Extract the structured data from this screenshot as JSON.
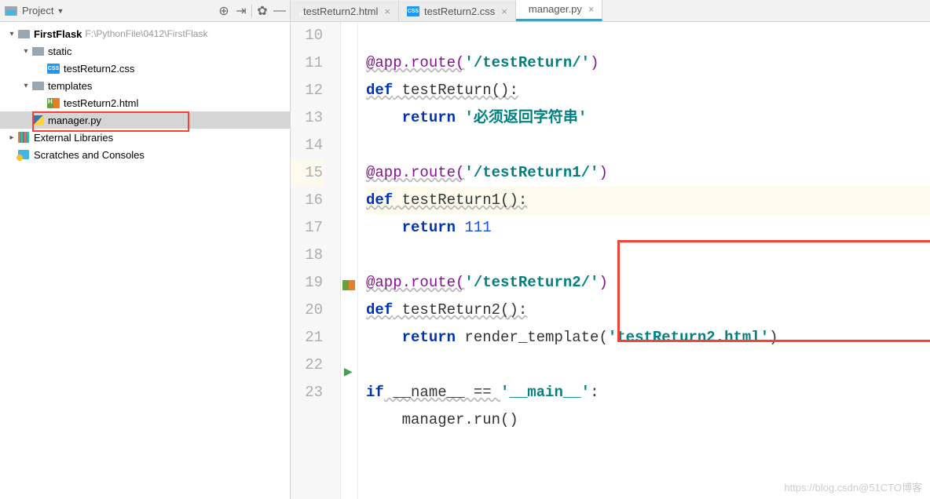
{
  "sidebar": {
    "title": "Project",
    "root": {
      "name": "FirstFlask",
      "path": "F:\\PythonFile\\0412\\FirstFlask"
    },
    "static": {
      "name": "static"
    },
    "static_child": {
      "name": "testReturn2.css"
    },
    "templates": {
      "name": "templates"
    },
    "templates_child": {
      "name": "testReturn2.html"
    },
    "manager": {
      "name": "manager.py"
    },
    "ext_lib": {
      "name": "External Libraries"
    },
    "scratch": {
      "name": "Scratches and Consoles"
    }
  },
  "tabs": [
    {
      "label": "testReturn2.html",
      "type": "html"
    },
    {
      "label": "testReturn2.css",
      "type": "css"
    },
    {
      "label": "manager.py",
      "type": "py",
      "active": true
    }
  ],
  "code": {
    "l10": {
      "a": "@app.route(",
      "b": "'/testReturn/'",
      "c": ")"
    },
    "l11": {
      "a": "def",
      "b": " testReturn():"
    },
    "l12": {
      "a": "return",
      "b": " ",
      "c": "'必须返回字符串'"
    },
    "l14": {
      "a": "@app.route(",
      "b": "'/testReturn1/'",
      "c": ")"
    },
    "l15": {
      "a": "def",
      "b": " testReturn1():"
    },
    "l16": {
      "a": "return",
      "b": " ",
      "c": "111"
    },
    "l18": {
      "a": "@app.route(",
      "b": "'/testReturn2/'",
      "c": ")"
    },
    "l19": {
      "a": "def",
      "b": " testReturn2():"
    },
    "l20": {
      "a": "return",
      "b": " render_template(",
      "c": "'testReturn2.html'",
      "d": ")"
    },
    "l22": {
      "a": "if",
      "b": " __name__ == ",
      "c": "'__main__'",
      "d": ":"
    },
    "l23": {
      "a": "manager.run()"
    }
  },
  "line_numbers": [
    "10",
    "11",
    "12",
    "13",
    "14",
    "15",
    "16",
    "17",
    "18",
    "19",
    "20",
    "21",
    "22",
    "23"
  ],
  "watermark": "https://blog.csdn@51CTO博客"
}
